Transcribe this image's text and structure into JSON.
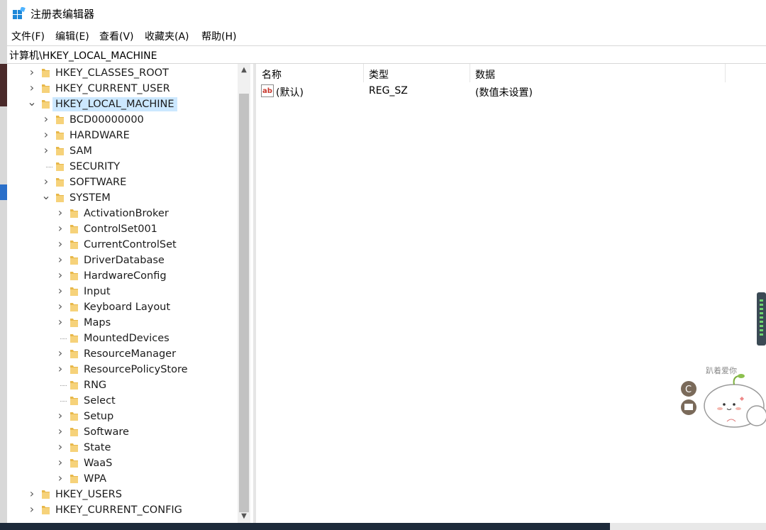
{
  "window": {
    "title": "注册表编辑器"
  },
  "menu": [
    "文件(F)",
    "编辑(E)",
    "查看(V)",
    "收藏夹(A)",
    "帮助(H)"
  ],
  "address": "计算机\\HKEY_LOCAL_MACHINE",
  "tree": [
    {
      "label": "HKEY_CLASSES_ROOT",
      "level": 0,
      "expander": "collapsed"
    },
    {
      "label": "HKEY_CURRENT_USER",
      "level": 0,
      "expander": "collapsed"
    },
    {
      "label": "HKEY_LOCAL_MACHINE",
      "level": 0,
      "expander": "expanded",
      "selected": true
    },
    {
      "label": "BCD00000000",
      "level": 1,
      "expander": "collapsed"
    },
    {
      "label": "HARDWARE",
      "level": 1,
      "expander": "collapsed"
    },
    {
      "label": "SAM",
      "level": 1,
      "expander": "collapsed"
    },
    {
      "label": "SECURITY",
      "level": 1,
      "expander": "none"
    },
    {
      "label": "SOFTWARE",
      "level": 1,
      "expander": "collapsed"
    },
    {
      "label": "SYSTEM",
      "level": 1,
      "expander": "expanded"
    },
    {
      "label": "ActivationBroker",
      "level": 2,
      "expander": "collapsed"
    },
    {
      "label": "ControlSet001",
      "level": 2,
      "expander": "collapsed"
    },
    {
      "label": "CurrentControlSet",
      "level": 2,
      "expander": "collapsed"
    },
    {
      "label": "DriverDatabase",
      "level": 2,
      "expander": "collapsed"
    },
    {
      "label": "HardwareConfig",
      "level": 2,
      "expander": "collapsed"
    },
    {
      "label": "Input",
      "level": 2,
      "expander": "collapsed"
    },
    {
      "label": "Keyboard Layout",
      "level": 2,
      "expander": "collapsed"
    },
    {
      "label": "Maps",
      "level": 2,
      "expander": "collapsed"
    },
    {
      "label": "MountedDevices",
      "level": 2,
      "expander": "none"
    },
    {
      "label": "ResourceManager",
      "level": 2,
      "expander": "collapsed"
    },
    {
      "label": "ResourcePolicyStore",
      "level": 2,
      "expander": "collapsed"
    },
    {
      "label": "RNG",
      "level": 2,
      "expander": "none"
    },
    {
      "label": "Select",
      "level": 2,
      "expander": "none"
    },
    {
      "label": "Setup",
      "level": 2,
      "expander": "collapsed"
    },
    {
      "label": "Software",
      "level": 2,
      "expander": "collapsed"
    },
    {
      "label": "State",
      "level": 2,
      "expander": "collapsed"
    },
    {
      "label": "WaaS",
      "level": 2,
      "expander": "collapsed"
    },
    {
      "label": "WPA",
      "level": 2,
      "expander": "collapsed"
    },
    {
      "label": "HKEY_USERS",
      "level": 0,
      "expander": "collapsed"
    },
    {
      "label": "HKEY_CURRENT_CONFIG",
      "level": 0,
      "expander": "collapsed"
    }
  ],
  "list": {
    "columns": [
      "名称",
      "类型",
      "数据"
    ],
    "rows": [
      {
        "name": "(默认)",
        "type": "REG_SZ",
        "data": "(数值未设置)",
        "icon": "string-value-icon"
      }
    ]
  },
  "colors": {
    "selection": "#cce8ff",
    "folder": "#e8b84a",
    "ab_icon": "#c8372d"
  },
  "sticker": {
    "text": "趴着爱你"
  }
}
